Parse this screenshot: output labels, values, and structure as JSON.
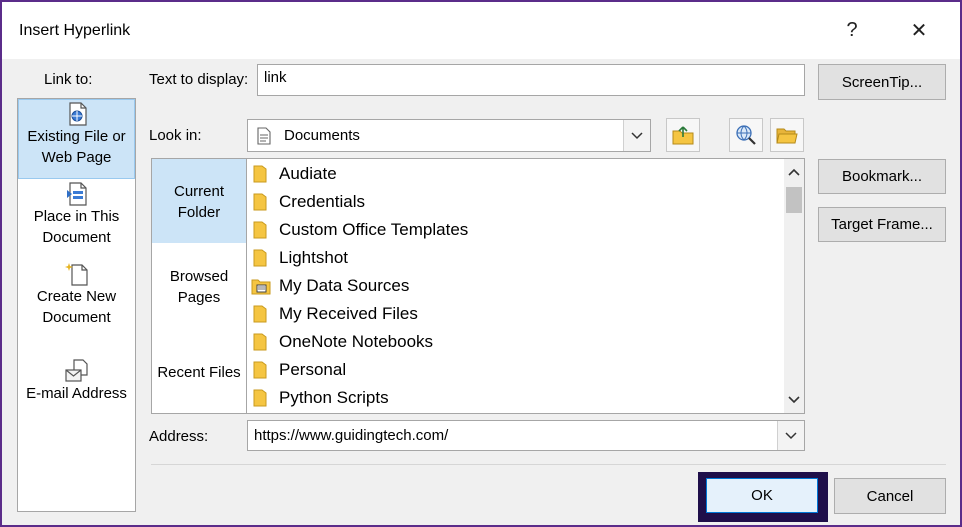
{
  "window": {
    "title": "Insert Hyperlink",
    "help_glyph": "?",
    "close_glyph": "✕"
  },
  "link_to": {
    "label": "Link to:",
    "items": [
      {
        "line1": "Existing File or",
        "line2": "Web Page",
        "icon": "existing-file-icon",
        "selected": true
      },
      {
        "line1": "Place in This",
        "line2": "Document",
        "icon": "place-in-document-icon",
        "selected": false
      },
      {
        "line1": "Create New",
        "line2": "Document",
        "icon": "new-document-icon",
        "selected": false
      },
      {
        "line1": "E-mail Address",
        "line2": "",
        "icon": "email-icon",
        "selected": false
      }
    ]
  },
  "text_to_display": {
    "label": "Text to display:",
    "value": "link"
  },
  "screentip_label": "ScreenTip...",
  "look_in": {
    "label": "Look in:",
    "value": "Documents"
  },
  "subnav": [
    {
      "line1": "Current",
      "line2": "Folder",
      "selected": true
    },
    {
      "line1": "Browsed",
      "line2": "Pages",
      "selected": false
    },
    {
      "line1": "Recent Files",
      "line2": "",
      "selected": false
    }
  ],
  "files": [
    {
      "name": "Audiate",
      "icon": "folder-icon"
    },
    {
      "name": "Credentials",
      "icon": "folder-icon"
    },
    {
      "name": "Custom Office Templates",
      "icon": "folder-icon"
    },
    {
      "name": "Lightshot",
      "icon": "folder-icon"
    },
    {
      "name": "My Data Sources",
      "icon": "data-source-folder-icon"
    },
    {
      "name": "My Received Files",
      "icon": "folder-icon"
    },
    {
      "name": "OneNote Notebooks",
      "icon": "folder-icon"
    },
    {
      "name": "Personal",
      "icon": "folder-icon"
    },
    {
      "name": "Python Scripts",
      "icon": "folder-icon"
    }
  ],
  "bookmark_label": "Bookmark...",
  "target_frame_label": "Target Frame...",
  "address": {
    "label": "Address:",
    "value": "https://www.guidingtech.com/"
  },
  "ok_label": "OK",
  "cancel_label": "Cancel",
  "colors": {
    "selection": "#cce4f7",
    "frame": "#5b2c8a",
    "ok_highlight": "#1f0f4a",
    "folder": "#f5c542"
  }
}
